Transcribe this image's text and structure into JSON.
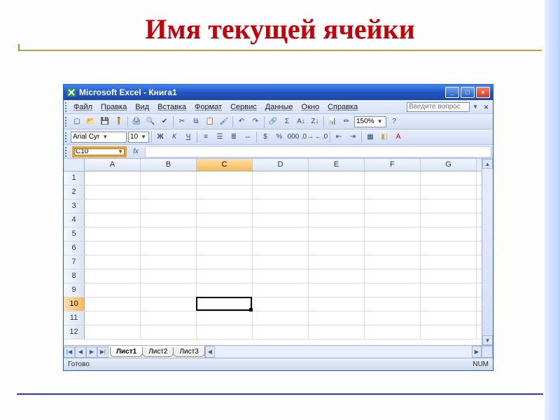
{
  "slide": {
    "heading": "Имя текущей ячейки"
  },
  "window": {
    "titlebar": "Microsoft Excel - Книга1",
    "minimize": "_",
    "maximize": "□",
    "close": "×"
  },
  "menu": {
    "file": "Файл",
    "edit": "Правка",
    "view": "Вид",
    "insert": "Вставка",
    "format": "Формат",
    "tools": "Сервис",
    "data": "Данные",
    "window": "Окно",
    "help": "Справка",
    "help_placeholder": "Введите вопрос",
    "doc_close": "×"
  },
  "toolbar_std": {
    "zoom": "150%"
  },
  "toolbar_fmt": {
    "font": "Arial Cyr",
    "size": "10",
    "bold": "Ж",
    "italic": "К",
    "underline": "Ч"
  },
  "formula_bar": {
    "name_box": "C10",
    "fx": "fx"
  },
  "columns": [
    "A",
    "B",
    "C",
    "D",
    "E",
    "F",
    "G"
  ],
  "rows": [
    "1",
    "2",
    "3",
    "4",
    "5",
    "6",
    "7",
    "8",
    "9",
    "10",
    "11",
    "12"
  ],
  "selected": {
    "col": "C",
    "row": "10"
  },
  "tabs": {
    "t1": "Лист1",
    "t2": "Лист2",
    "t3": "Лист3"
  },
  "status": {
    "ready": "Готово",
    "num": "NUM"
  }
}
